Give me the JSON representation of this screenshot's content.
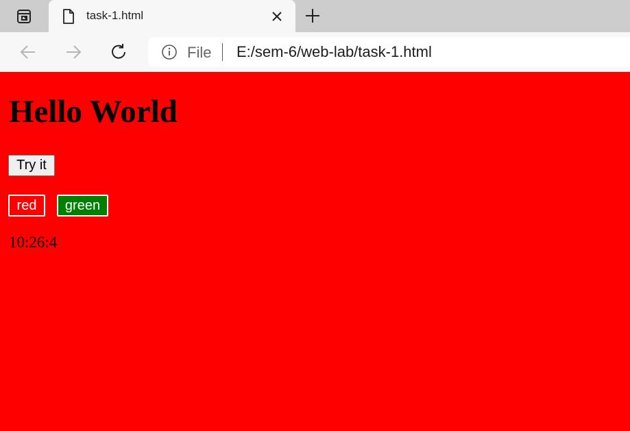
{
  "browser": {
    "tab": {
      "title": "task-1.html",
      "icon": "document-icon"
    },
    "address_bar": {
      "scheme_label": "File",
      "url": "E:/sem-6/web-lab/task-1.html"
    },
    "icons": {
      "workspaces": "workspaces-icon",
      "close_tab": "close-icon",
      "new_tab": "plus-icon",
      "back": "back-arrow-icon",
      "forward": "forward-arrow-icon",
      "reload": "reload-icon",
      "site_info": "info-icon"
    }
  },
  "page": {
    "background_color": "#ff0000",
    "heading": "Hello World",
    "try_button_label": "Try it",
    "color_buttons": [
      {
        "label": "red",
        "color": "#ff0000"
      },
      {
        "label": "green",
        "color": "#008000"
      }
    ],
    "clock_text": "10:26:4"
  }
}
